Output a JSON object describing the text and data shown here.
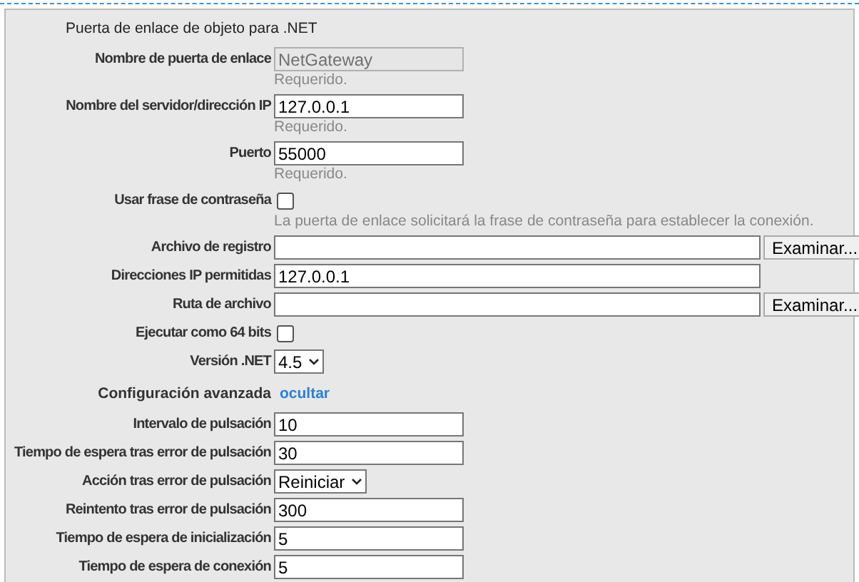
{
  "title": "Puerta de enlace de objeto para .NET",
  "fields": [
    {
      "kind": "text",
      "label": "Nombre de puerta de enlace",
      "value": "NetGateway",
      "disabled": true,
      "hint": "Requerido."
    },
    {
      "kind": "text",
      "label": "Nombre del servidor/dirección IP",
      "value": "127.0.0.1",
      "disabled": false,
      "hint": "Requerido."
    },
    {
      "kind": "text",
      "label": "Puerto",
      "value": "55000",
      "disabled": false,
      "hint": "Requerido."
    },
    {
      "kind": "checkbox",
      "label": "Usar frase de contraseña",
      "checked": false,
      "hint": "La puerta de enlace solicitará la frase de contraseña para establecer la conexión."
    },
    {
      "kind": "file",
      "label": "Archivo de registro",
      "button": "Examinar..."
    },
    {
      "kind": "wide",
      "label": "Direcciones IP permitidas",
      "value": "127.0.0.1"
    },
    {
      "kind": "file",
      "label": "Ruta de archivo",
      "button": "Examinar..."
    },
    {
      "kind": "checkbox",
      "label": "Ejecutar como 64 bits",
      "checked": false
    },
    {
      "kind": "select",
      "label": "Versión .NET",
      "value": "4.5"
    }
  ],
  "advanced": {
    "label": "Configuración avanzada",
    "link": "ocultar",
    "fields": [
      {
        "kind": "text",
        "label": "Intervalo de pulsación",
        "value": "10"
      },
      {
        "kind": "text",
        "label": "Tiempo de espera tras error de pulsación",
        "value": "30"
      },
      {
        "kind": "select",
        "label": "Acción tras error de pulsación",
        "value": "Reiniciar"
      },
      {
        "kind": "text",
        "label": "Reintento tras error de pulsación",
        "value": "300"
      },
      {
        "kind": "text",
        "label": "Tiempo de espera de inicialización",
        "value": "5"
      },
      {
        "kind": "text",
        "label": "Tiempo de espera de conexión",
        "value": "5"
      }
    ]
  }
}
